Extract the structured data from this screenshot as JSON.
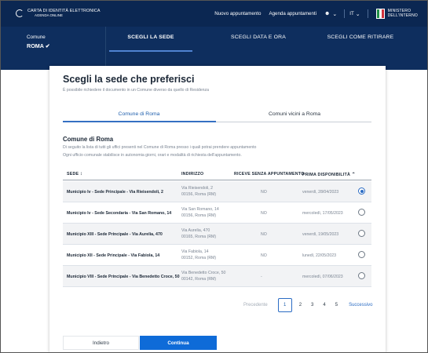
{
  "header": {
    "logo_line1": "CARTA DI IDENTITÀ ELETTRONICA",
    "logo_line2": "AGENDA ONLINE",
    "nav_new": "Nuovo appuntamento",
    "nav_agenda": "Agenda appuntamenti",
    "user_icon": "user-icon",
    "language": "IT",
    "ministry_line1": "MINISTERO",
    "ministry_line2": "DELL'INTERNO",
    "colors": {
      "bar": "#0b2752",
      "steps": "#0e2e5e",
      "accent": "#0e6bd8"
    }
  },
  "steps": {
    "comune_label": "Comune",
    "comune_value": "ROMA",
    "check_icon": "check-icon",
    "step1": "SCEGLI LA SEDE",
    "step2": "SCEGLI DATA E ORA",
    "step3": "SCEGLI COME RITIRARE",
    "active_step": 1
  },
  "main": {
    "title": "Scegli la sede che preferisci",
    "subtitle": "È possibile richiedere il documento in un Comune diverso da quello di Residenza",
    "tabs": [
      {
        "label": "Comune di Roma",
        "active": true
      },
      {
        "label": "Comuni vicini a Roma",
        "active": false
      }
    ],
    "section_title": "Comune di Roma",
    "desc1": "Di seguito la lista di tutti gli uffici presenti nel Comune di Roma presso i quali potrai prendere appuntamento",
    "desc2": "Ogni ufficio comunale stabilisce in autonomia giorni, orari e modalità di richiesta dell'appuntamento."
  },
  "table": {
    "headers": [
      "SEDE",
      "INDIRIZZO",
      "RICEVE SENZA APPUNTAMENTO",
      "PRIMA DISPONIBILITÀ"
    ],
    "rows": [
      {
        "sede": "Municipio Iv - Sede Principale - Via Rieisendoli, 2",
        "addr1": "Via Rieisendoli, 2",
        "addr2": "00156, Roma (RM)",
        "no_appt": "NO",
        "date": "venerdì, 28/04/2023",
        "selected": true
      },
      {
        "sede": "Municipio Iv - Sede Secondaria - Via San Romano, 14",
        "addr1": "Via San Romano, 14",
        "addr2": "00156, Roma (RM)",
        "no_appt": "NO",
        "date": "mercoledì, 17/05/2023",
        "selected": false
      },
      {
        "sede": "Municipio XIII - Sede Principale - Via Aurelia, 470",
        "addr1": "Via Aurelia, 470",
        "addr2": "00165, Roma (RM)",
        "no_appt": "NO",
        "date": "venerdì, 19/05/2023",
        "selected": false
      },
      {
        "sede": "Municipio XII - Sede Principale - Via Fabiola, 14",
        "addr1": "Via Fabiola, 14",
        "addr2": "00152, Roma (RM)",
        "no_appt": "NO",
        "date": "lunedì, 22/05/2023",
        "selected": false
      },
      {
        "sede": "Municipio VIII - Sede Principale - Via Benedetto Croce, 50",
        "addr1": "Via Benedetto Croce, 50",
        "addr2": "00142, Roma (RM)",
        "no_appt": "-",
        "date": "mercoledì, 07/06/2023",
        "selected": false
      }
    ]
  },
  "pagination": {
    "prev": "Precedente",
    "pages": [
      "1",
      "2",
      "3",
      "4",
      "5"
    ],
    "current": "1",
    "next": "Successivo"
  },
  "actions": {
    "back": "Indietro",
    "continue": "Continua"
  }
}
